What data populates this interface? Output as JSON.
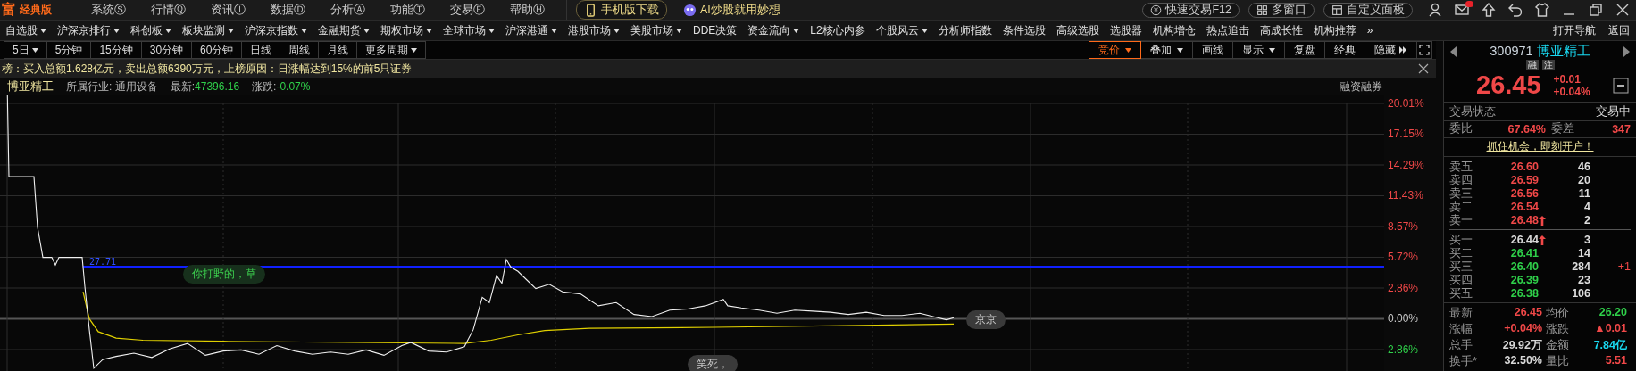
{
  "app": {
    "logo": "富",
    "edition": "经典版"
  },
  "menu": [
    "系统Ⓢ",
    "行情Ⓠ",
    "资讯Ⓘ",
    "数据Ⓓ",
    "分析Ⓐ",
    "功能Ⓣ",
    "交易Ⓔ",
    "帮助Ⓗ"
  ],
  "promo_buttons": [
    {
      "label": "手机版下载",
      "kind": "phone"
    },
    {
      "label": "AI炒股就用妙想",
      "kind": "ai"
    }
  ],
  "window_buttons": [
    {
      "label": "快速交易F12",
      "kind": "trade"
    },
    {
      "label": "多窗口",
      "kind": "windows"
    },
    {
      "label": "自定义面板",
      "kind": "panel"
    }
  ],
  "mail_unread": true,
  "nav": [
    {
      "label": "自选股",
      "dropdown": true
    },
    {
      "label": "沪深京排行",
      "dropdown": true
    },
    {
      "label": "科创板",
      "dropdown": true
    },
    {
      "label": "板块监测",
      "dropdown": true
    },
    {
      "label": "沪深京指数",
      "dropdown": true
    },
    {
      "label": "金融期货",
      "dropdown": true
    },
    {
      "label": "期权市场",
      "dropdown": true
    },
    {
      "label": "全球市场",
      "dropdown": true
    },
    {
      "label": "沪深港通",
      "dropdown": true
    },
    {
      "label": "港股市场",
      "dropdown": true
    },
    {
      "label": "美股市场",
      "dropdown": true
    },
    {
      "label": "DDE决策",
      "dropdown": false
    },
    {
      "label": "资金流向",
      "dropdown": true
    },
    {
      "label": "L2核心内参",
      "dropdown": false
    },
    {
      "label": "个股风云",
      "dropdown": true
    },
    {
      "label": "分析师指数",
      "dropdown": false
    },
    {
      "label": "条件选股",
      "dropdown": false
    },
    {
      "label": "高级选股",
      "dropdown": false
    },
    {
      "label": "选股器",
      "dropdown": false
    },
    {
      "label": "机构增仓",
      "dropdown": false
    },
    {
      "label": "热点追击",
      "dropdown": false
    },
    {
      "label": "高成长性",
      "dropdown": false
    },
    {
      "label": "机构推荐",
      "dropdown": false
    }
  ],
  "nav_more": "»",
  "nav_right": [
    "打开导航",
    "返回"
  ],
  "periods": [
    {
      "label": "5日",
      "dropdown": true,
      "selected": false
    },
    {
      "label": "5分钟",
      "dropdown": false,
      "selected": false
    },
    {
      "label": "15分钟",
      "dropdown": false,
      "selected": false
    },
    {
      "label": "30分钟",
      "dropdown": false,
      "selected": false
    },
    {
      "label": "60分钟",
      "dropdown": false,
      "selected": false
    },
    {
      "label": "日线",
      "dropdown": false,
      "selected": false
    },
    {
      "label": "周线",
      "dropdown": false,
      "selected": false
    },
    {
      "label": "月线",
      "dropdown": false,
      "selected": false
    },
    {
      "label": "更多周期",
      "dropdown": true,
      "selected": false
    }
  ],
  "tools": [
    {
      "label": "竞价",
      "dropdown": true,
      "selected": true
    },
    {
      "label": "叠加",
      "dropdown": true,
      "selected": false
    },
    {
      "label": "画线",
      "dropdown": false,
      "selected": false
    },
    {
      "label": "显示",
      "dropdown": true,
      "selected": false
    },
    {
      "label": "复盘",
      "dropdown": false,
      "selected": false
    },
    {
      "label": "经典",
      "dropdown": false,
      "selected": false
    },
    {
      "label": "隐藏",
      "dropdown": false,
      "selected": false
    }
  ],
  "news": "榜：买入总额1.628亿元，卖出总额6390万元，上榜原因：日涨幅达到15%的前5只证券",
  "stock_header": {
    "name": "博亚精工",
    "industry_label": "所属行业:",
    "industry": "通用设备",
    "latest_label": "最新:",
    "latest": "47396.16",
    "change_label": "涨跌:",
    "change": "-0.07%",
    "margin": "融资融券"
  },
  "chart": {
    "axis_labels": [
      {
        "text": "20.01%",
        "color": "#f04848"
      },
      {
        "text": "17.15%",
        "color": "#f04848"
      },
      {
        "text": "14.29%",
        "color": "#f04848"
      },
      {
        "text": "11.43%",
        "color": "#f04848"
      },
      {
        "text": "8.57%",
        "color": "#f04848"
      },
      {
        "text": "5.72%",
        "color": "#f04848"
      },
      {
        "text": "2.86%",
        "color": "#f04848"
      },
      {
        "text": "0.00%",
        "color": "#c8c8c8"
      },
      {
        "text": "2.86%",
        "color": "#2fd04a"
      }
    ],
    "reference_label": "27.71",
    "comments": [
      {
        "text": "你打野的，草",
        "kind": "highlight"
      },
      {
        "text": "京京",
        "kind": "normal"
      },
      {
        "text": "笑死，",
        "kind": "normal"
      }
    ]
  },
  "quote": {
    "code": "300971",
    "name": "博亚精工",
    "badges": [
      "融",
      "注"
    ],
    "price": "26.45",
    "change": "+0.01",
    "change_pct": "+0.04%",
    "status_label": "交易状态",
    "status": "交易中",
    "ratio_label": "委比",
    "ratio": "67.64%",
    "diff_label": "委差",
    "diff": "347",
    "promo": "抓住机会，即刻开户！",
    "asks": [
      {
        "label": "卖五",
        "price": "26.60",
        "volume": "46",
        "color": "#f04848",
        "arrow": false
      },
      {
        "label": "卖四",
        "price": "26.59",
        "volume": "20",
        "color": "#f04848",
        "arrow": false
      },
      {
        "label": "卖三",
        "price": "26.56",
        "volume": "11",
        "color": "#f04848",
        "arrow": false
      },
      {
        "label": "卖二",
        "price": "26.54",
        "volume": "4",
        "color": "#f04848",
        "arrow": false
      },
      {
        "label": "卖一",
        "price": "26.48",
        "volume": "2",
        "color": "#f04848",
        "arrow": true
      }
    ],
    "bids": [
      {
        "label": "买一",
        "price": "26.44",
        "volume": "3",
        "color": "#d8d8d8",
        "arrow": true
      },
      {
        "label": "买二",
        "price": "26.41",
        "volume": "14",
        "color": "#2fd04a",
        "arrow": false
      },
      {
        "label": "买三",
        "price": "26.40",
        "volume": "284",
        "color": "#2fd04a",
        "arrow": false,
        "change": "+1"
      },
      {
        "label": "买四",
        "price": "26.39",
        "volume": "23",
        "color": "#2fd04a",
        "arrow": false
      },
      {
        "label": "买五",
        "price": "26.38",
        "volume": "106",
        "color": "#2fd04a",
        "arrow": false
      }
    ],
    "stats": [
      {
        "label": "最新",
        "value": "26.45",
        "color": "#f04848"
      },
      {
        "label": "均价",
        "value": "26.20",
        "color": "#2fd04a"
      },
      {
        "label": "涨幅",
        "value": "+0.04%",
        "color": "#f04848"
      },
      {
        "label": "涨跌",
        "value": "▲0.01",
        "color": "#f04848"
      },
      {
        "label": "总手",
        "value": "29.92万",
        "color": "#d8d8d8"
      },
      {
        "label": "金额",
        "value": "7.84亿",
        "color": "#19d8f0"
      },
      {
        "label": "换手*",
        "value": "32.50%",
        "color": "#d8d8d8"
      },
      {
        "label": "量比",
        "value": "5.51",
        "color": "#f04848"
      }
    ]
  }
}
